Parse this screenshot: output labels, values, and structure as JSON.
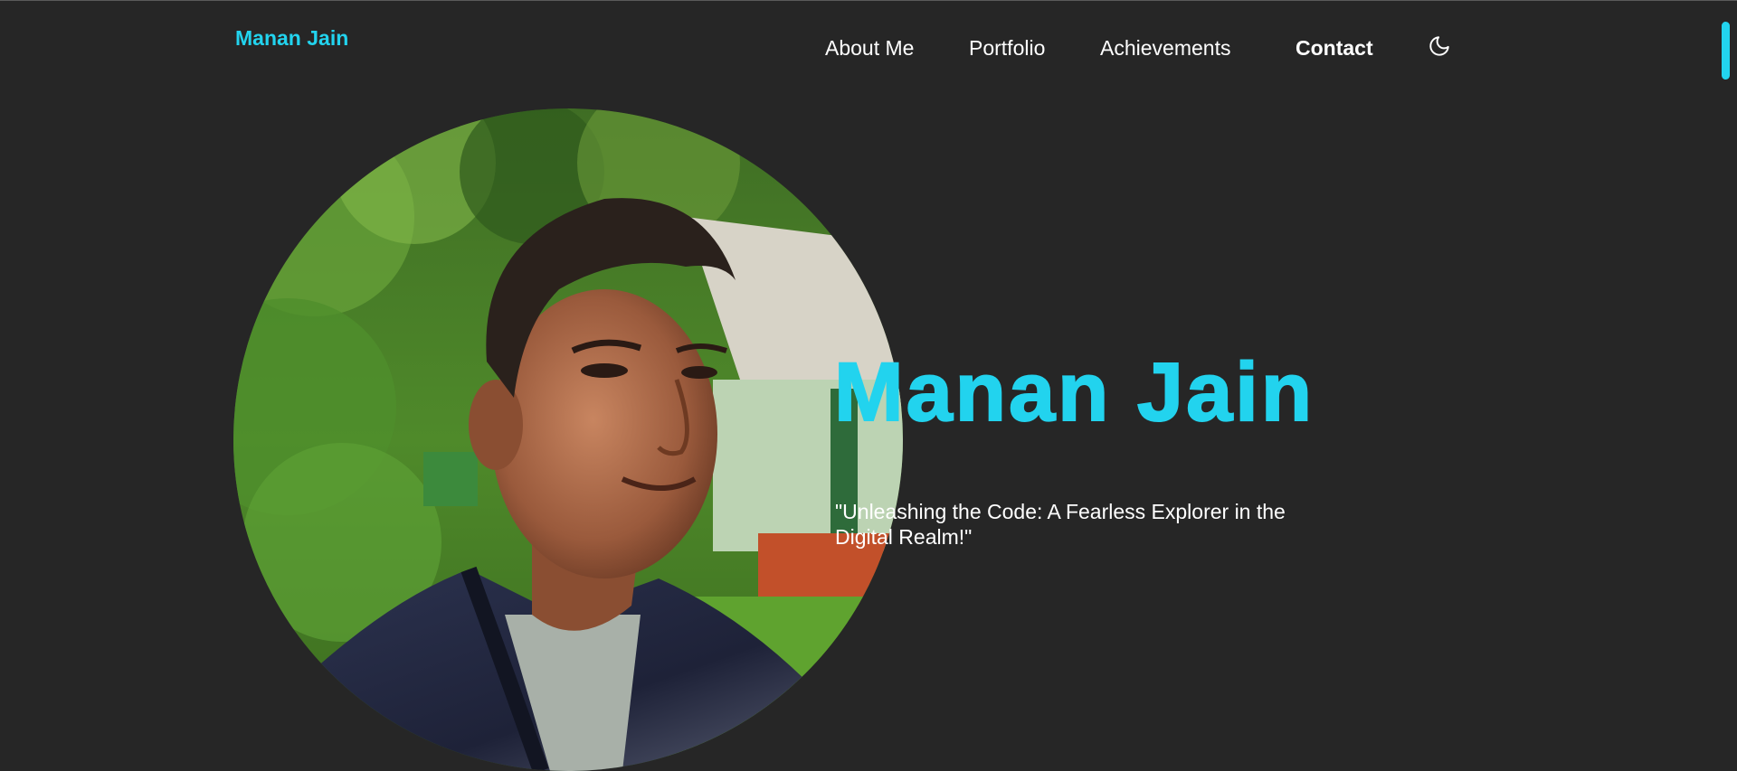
{
  "header": {
    "brand": "Manan Jain",
    "nav": [
      {
        "label": "About Me"
      },
      {
        "label": "Portfolio"
      },
      {
        "label": "Achievements"
      },
      {
        "label": "Contact",
        "active": true
      }
    ],
    "theme_toggle_icon": "moon-icon"
  },
  "hero": {
    "name": "Manan Jain",
    "tagline": "\"Unleashing the Code: A Fearless Explorer in the Digital Realm!\""
  },
  "colors": {
    "background": "#262626",
    "accent": "#22d3ee",
    "text": "#ffffff"
  }
}
